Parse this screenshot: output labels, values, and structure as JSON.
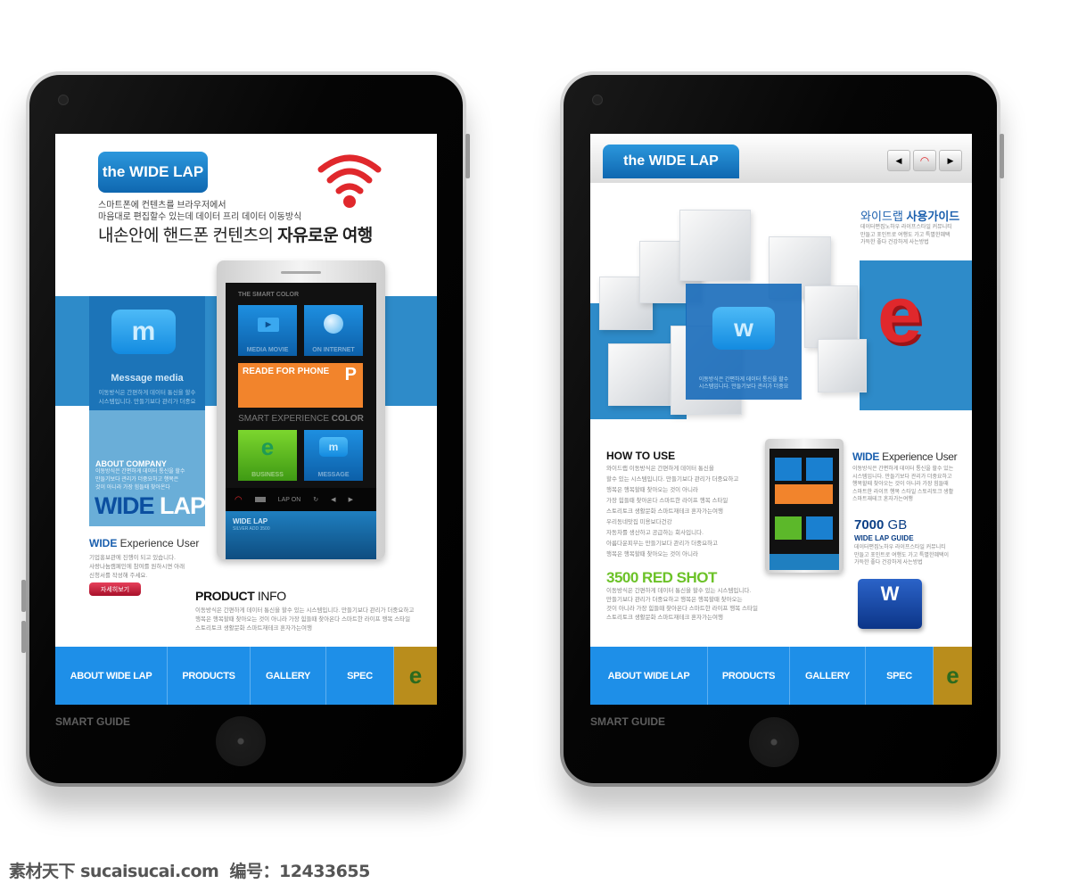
{
  "left": {
    "title": "the WIDE LAP",
    "intro_lines": [
      "스마트폰에 컨텐츠를 브라우저에서",
      "마음대로 편집할수 있는데 데이터 프리 데이터 이동방식"
    ],
    "headline_regular": "내손안에 핸드폰 컨텐츠의 ",
    "headline_bold": "자유로운 여행",
    "message_media": {
      "icon_letter": "m",
      "title": "Message media",
      "text": [
        "이동방식은 간편하게 데이터 통신을 할수",
        "시스템입니다. 만들기보다 관리가 더중요"
      ]
    },
    "about": {
      "title": "ABOUT COMPANY",
      "text": [
        "이동방식은 간편하게 데이터 통신을 할수",
        "만들기보다 관리가 더중요하고 행복은",
        "것이 아니라 가장 힘들때 찾아온다"
      ],
      "big_dark": "WIDE",
      "big_light": " LAP"
    },
    "experience": {
      "title_bold": "WIDE",
      "title_rest": " Experience User",
      "text": [
        "기업홍보관에 진행이 되고 있습니다.",
        "사랑나눔캠페인에 참여를 원하시면 아래",
        "신청서를 작성해 주세요."
      ],
      "button": "자세히보기"
    },
    "phone": {
      "header": "THE SMART COLOR",
      "tiles": [
        "MEDIA MOVIE",
        "ON INTERNET"
      ],
      "banner_title": "READE FOR PHONE",
      "banner_letter": "P",
      "section_light": "SMART EXPERIENCE ",
      "section_bold": "COLOR",
      "tiles2": [
        "BUSINESS",
        "MESSAGE"
      ],
      "tile2_letters": [
        "e",
        "m"
      ],
      "status_text": "LAP ON",
      "footer_title": "WIDE LAP",
      "footer_sub": "SILVER ADD 3500"
    },
    "product": {
      "title_bold": "PRODUCT",
      "title_rest": " INFO",
      "text": [
        "이동방식은 간편하게 데이터 통신을 할수 있는 시스템입니다. 만들기보다 관리가 더중요하고",
        "행복은 행복할때 찾아오는 것이 아니라 가장 힘들때 찾아온다 스마트한 라이프 행복 스타일",
        "스토리토크 생활문화 스마트재테크 혼자가는여행"
      ]
    },
    "nav": [
      "ABOUT WIDE LAP",
      "PRODUCTS",
      "GALLERY",
      "SPEC"
    ],
    "nav_logo": "e",
    "bezel_label": "SMART GUIDE"
  },
  "right": {
    "title": "the WIDE LAP",
    "guide_regular": "와이드랩 ",
    "guide_bold": "사용가이드",
    "guide_text": [
      "데이터편집노하우 라이프스타일 커뮤니티",
      "만들고 포인트로 여행도 가고 특별한혜택",
      "가득한 좋다 건강하게 사는방법"
    ],
    "w_letter": "w",
    "w_text": [
      "이동방식은 간편하게 데이터 통신을 할수",
      "시스템입니다. 만들기보다 관리가 더중요"
    ],
    "e_letter": "e",
    "how_to_use": {
      "title": "HOW TO USE",
      "text": [
        "와이드랩 이동방식은 간편하게 데이터 통신을",
        "할수 있는 시스템입니다. 만들기보다 관리가 더중요하고",
        "행복은 행복할때 찾아오는 것이 아니라",
        "가장 힘들때 찾아온다 스마트한 라이프 행복 스타일",
        "스토리토크 생활문화 스마트재테크 혼자가는여행",
        "우리동네맛집 미용보다건강",
        "자동차를 생산하고 공급하는 회사입니다.",
        "아름다운피부는 만들기보다 관리가 더중요하고",
        "행복은 행복할때 찾아오는 것이 아니라"
      ]
    },
    "red_shot": {
      "title": "3500 RED SHOT",
      "text": [
        "이동방식은 간편하게 데이터 통신을 할수 있는 시스템입니다.",
        "만들기보다 관리가 더중요하고 행복은 행복할때 찾아오는",
        "것이 아니라 가장 힘들때 찾아온다 스마트한 라이프 행복 스타일",
        "스토리토크 생활문화 스마트재테크 혼자가는여행"
      ]
    },
    "experience": {
      "title_bold": "WIDE",
      "title_rest": " Experience User",
      "text": [
        "이동방식은 간편하게 데이터 통신을 할수 있는",
        "시스템입니다. 만들기보다 관리가 더중요하고",
        "행복할때 찾아오는 것이 아니라 가장 힘들때",
        "스마트한 라이프 행복 스타일 스토리토크 생활",
        "스마트재테크 혼자가는여행"
      ]
    },
    "storage": {
      "value_bold": "7000",
      "unit": " GB",
      "subtitle": "WIDE LAP GUIDE",
      "text": [
        "데이터편집노하우 라이프스타일 커뮤니티",
        "만들고 포인트로 여행도 가고 특별한혜택이",
        "가득한 좋다 건강하게 사는방법"
      ]
    },
    "card_letter": "W",
    "nav": [
      "ABOUT WIDE LAP",
      "PRODUCTS",
      "GALLERY",
      "SPEC"
    ],
    "nav_logo": "e",
    "bezel_label": "SMART GUIDE"
  },
  "watermark": "素材天下 sucaisucai.com  编号：12433655",
  "colors": {
    "brand_blue": "#1e8fe8",
    "band_blue": "#2e8bc9",
    "wifi_red": "#e0282c",
    "orange": "#f2842c",
    "green": "#6cc228",
    "gold": "#b98d1c"
  },
  "icons": [
    "wifi-icon",
    "message-bubble-icon",
    "play-icon",
    "globe-icon",
    "prev-arrow-icon",
    "next-arrow-icon",
    "refresh-icon"
  ]
}
